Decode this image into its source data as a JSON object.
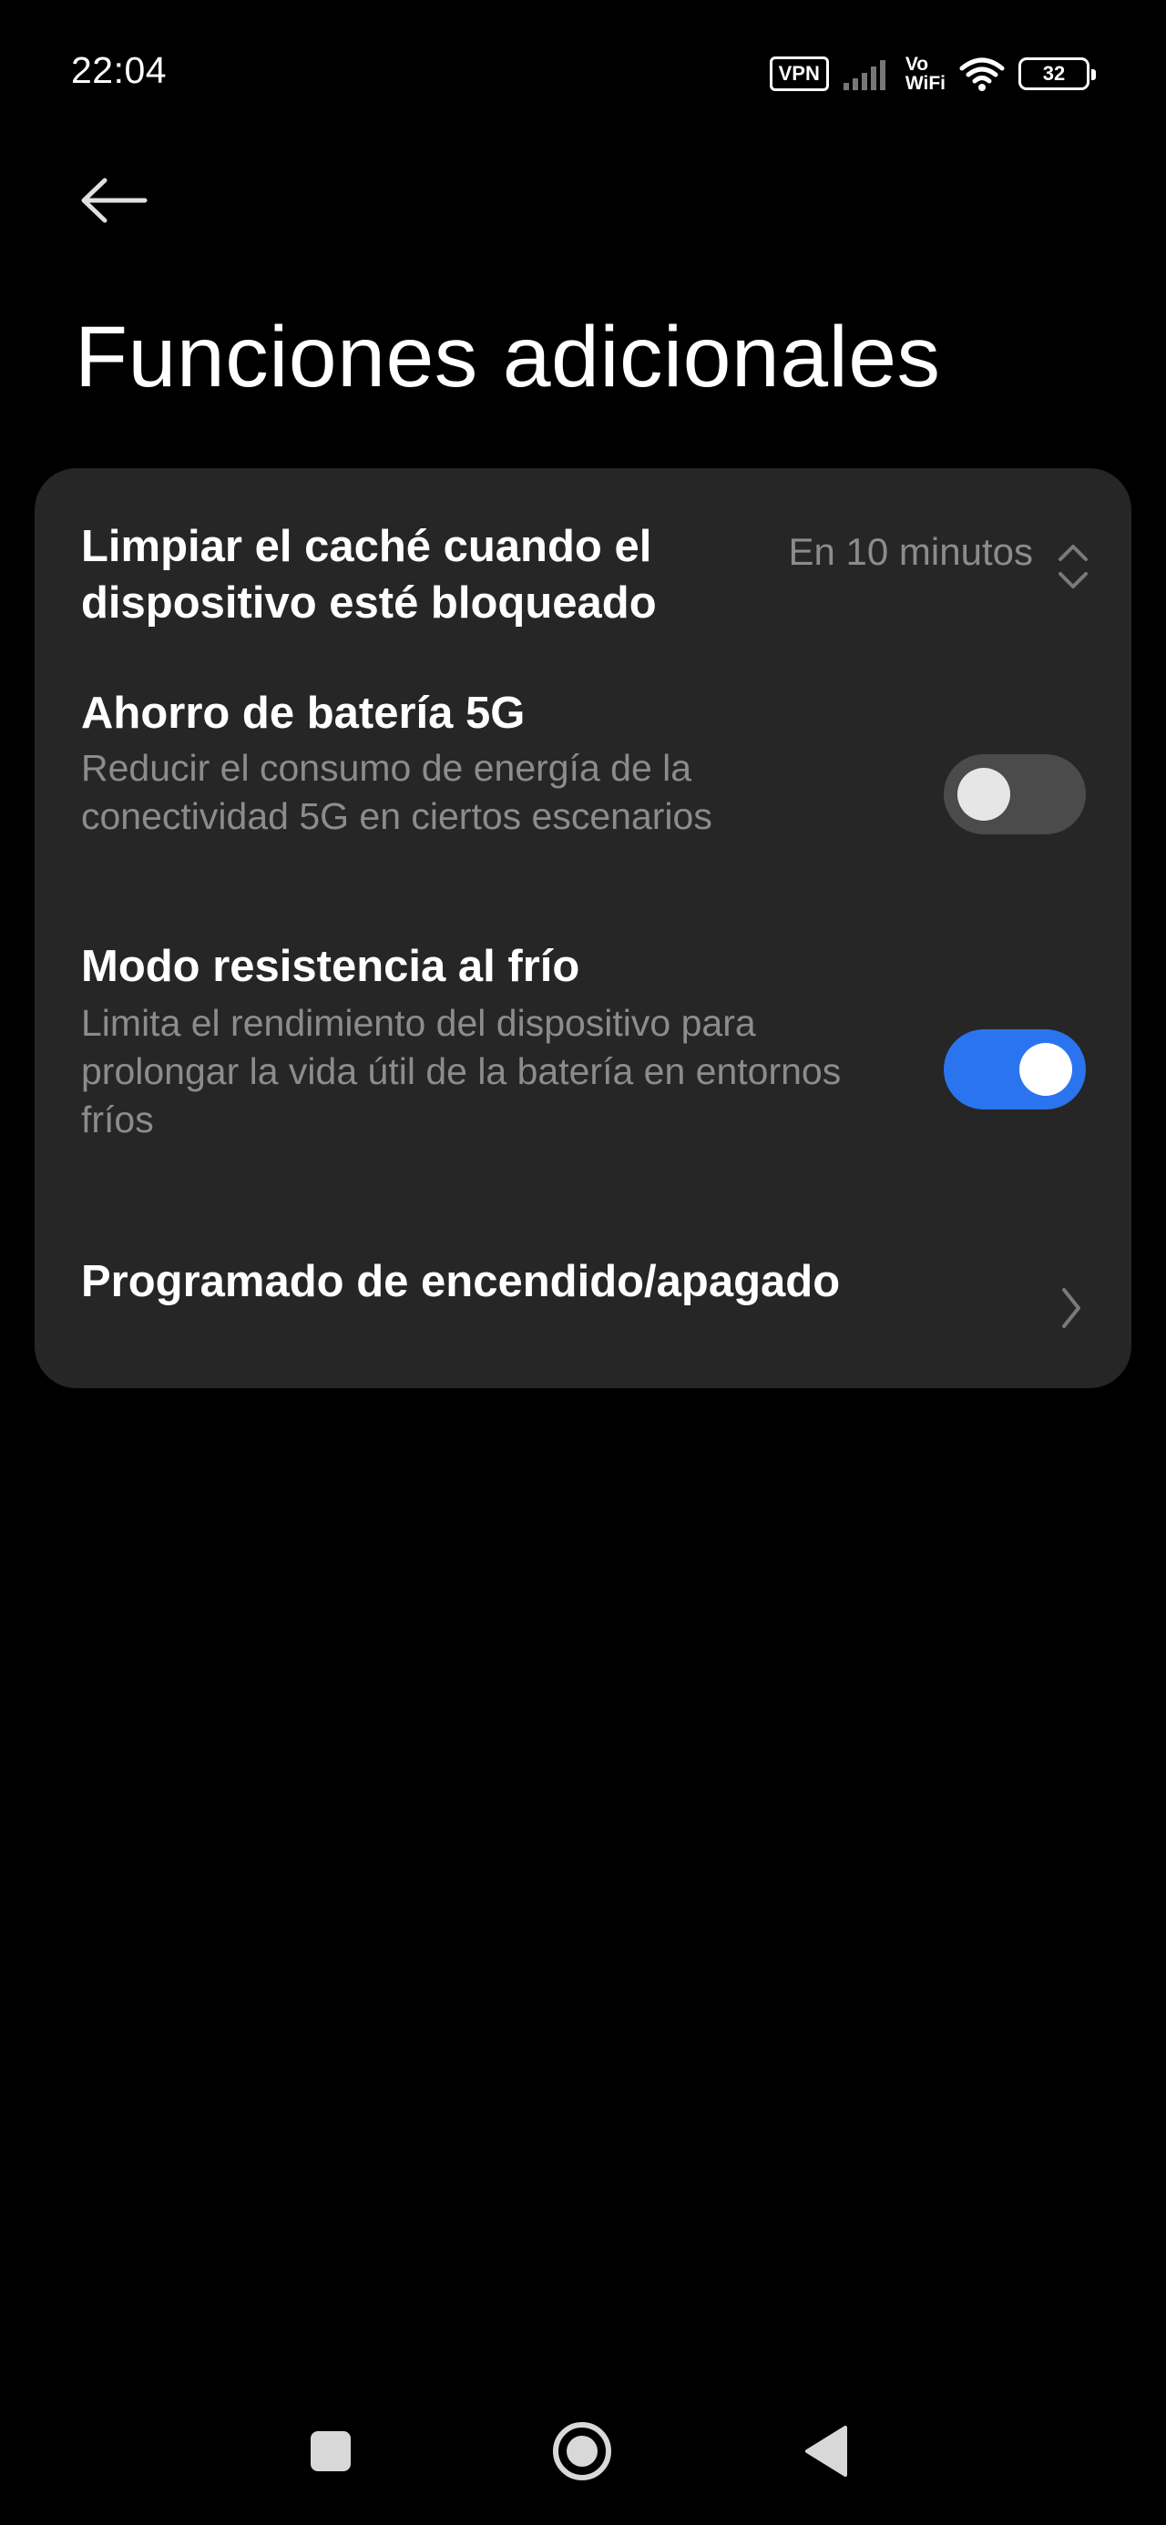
{
  "status_bar": {
    "time": "22:04",
    "vpn_label": "VPN",
    "vowifi_top": "Vo",
    "vowifi_bottom": "WiFi",
    "battery_level": "32",
    "icons": [
      "vpn-icon",
      "signal-icon",
      "vowifi-icon",
      "wifi-icon",
      "battery-icon"
    ]
  },
  "header": {
    "back_icon": "arrow-left-icon",
    "title": "Funciones adicionales"
  },
  "settings": {
    "clear_cache": {
      "title_line1": "Limpiar el caché cuando el",
      "title_line2": "dispositivo esté bloqueado",
      "value": "En 10 minutos",
      "icon": "up-down-chevron-icon"
    },
    "battery_5g": {
      "title": "Ahorro de batería 5G",
      "sub_line1": "Reducir el consumo de energía de la",
      "sub_line2": "conectividad 5G en ciertos escenarios",
      "enabled": false
    },
    "cold_mode": {
      "title": "Modo resistencia al frío",
      "sub_line1": "Limita el rendimiento del dispositivo para",
      "sub_line2": "prolongar la vida útil de la batería en entornos",
      "sub_line3": "fríos",
      "enabled": true
    },
    "schedule_power": {
      "title": "Programado de encendido/apagado",
      "icon": "chevron-right-icon"
    }
  },
  "nav_bar": {
    "buttons": [
      "recents-icon",
      "home-icon",
      "back-triangle-icon"
    ]
  },
  "colors": {
    "background": "#000000",
    "card": "#262626",
    "accent": "#2a75ef",
    "secondary_text": "#8c8c8c"
  }
}
